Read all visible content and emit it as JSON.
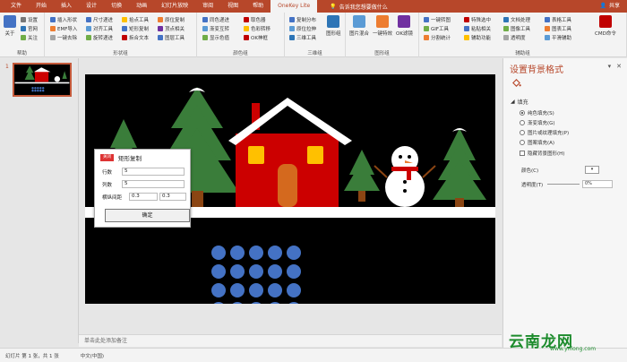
{
  "tabs": [
    "文件",
    "开始",
    "插入",
    "设计",
    "切换",
    "动画",
    "幻灯片放映",
    "审阅",
    "视图",
    "帮助",
    "OneKey Lite"
  ],
  "active_tab": "OneKey Lite",
  "search_placeholder": "告诉我您想要做什么",
  "user": "共享",
  "ribbon": {
    "help": {
      "about": "关于",
      "settings": "设置",
      "website": "官网",
      "follow": "关注",
      "group": "帮助"
    },
    "shape": {
      "insert_shape": "插入形状",
      "size_mark": "尺寸递进",
      "align_tool": "对齐工具",
      "emf_import": "EMF导入",
      "rotate_mark": "旋转递进",
      "one_key_remove": "一键去除",
      "matrix_copy": "矩形复制",
      "text_object": "拆合文本",
      "anchor_tool": "拾点工具",
      "original_copy": "原位复制",
      "vertex_tool": "顶点相关",
      "layer_tool": "图层工具",
      "group": "形状组"
    },
    "color": {
      "same_color": "同色递进",
      "gradient_mark": "渐变互转",
      "show_color": "显示色值",
      "color_picker": "取色器",
      "color_to": "色彩转移",
      "ok_neon": "OK神框",
      "group": "颜色组"
    },
    "three_d": {
      "copy_distribute": "复制分布",
      "glow_stretch": "原位拉伸",
      "three_d_tool": "三维工具",
      "shape_group": "图形组",
      "group": "三维组"
    },
    "image": {
      "image_mix": "图片混合",
      "one_key_effect": "一键特效",
      "ok_filter": "OK滤镜",
      "group": "图形组"
    },
    "aux": {
      "one_key_map": "一键转图",
      "gif_tool": "GIF工具",
      "split_tool": "分割统计",
      "special_select": "特殊选中",
      "paste_spread": "粘贴相关",
      "aux_func": "辅助功能",
      "text_tool": "文档处理",
      "image_tool": "图像工具",
      "transparent": "透明度",
      "table_tool": "表格工具",
      "chart_tool": "图表工具",
      "flat_split": "平滑辅助",
      "cmd_com": "CMD命令",
      "ok": "OK",
      "group": "辅助组"
    }
  },
  "thumb": {
    "number": "1"
  },
  "slide": {
    "house_colors": {
      "wall": "#cc0000",
      "roof": "#ffffff",
      "door": "#d4691e",
      "window": "#ffc000"
    },
    "tree_color": "#3a7d3a",
    "dot_color": "#4472c4"
  },
  "dialog": {
    "icon_label": "关闭",
    "title": "矩形复制",
    "rows_label": "行数",
    "rows_value": "5",
    "cols_label": "列数",
    "cols_value": "5",
    "spacing_label": "横纵间距",
    "h_spacing": "0.3",
    "v_spacing": "0.3",
    "ok": "确定"
  },
  "notes_placeholder": "单击此处添加备注",
  "pane": {
    "title": "设置背景格式",
    "section": "填充",
    "options": [
      "纯色填充(S)",
      "渐变填充(G)",
      "图片或纹理填充(P)",
      "图案填充(A)"
    ],
    "selected": 0,
    "hide_bg": "隐藏背景图形(H)",
    "color_label": "颜色(C)",
    "transparency_label": "透明度(T)",
    "transparency_value": "0%"
  },
  "status": {
    "slide_info": "幻灯片 第 1 张，共 1 张",
    "language": "中文(中国)"
  },
  "watermark": {
    "main": "云南龙网",
    "sub": "www.ynlong.com"
  }
}
